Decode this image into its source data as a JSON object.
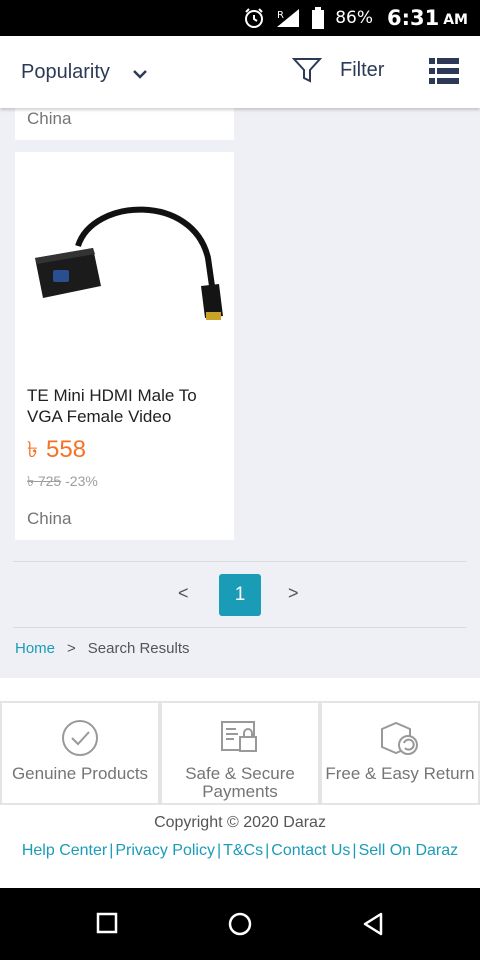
{
  "status_bar": {
    "battery": "86%",
    "time": "6:31",
    "ampm": "AM",
    "signal_label": "R"
  },
  "toolbar": {
    "sort_label": "Popularity",
    "filter_label": "Filter"
  },
  "products": [
    {
      "origin": "China"
    },
    {
      "title": "TE Mini HDMI Male To VGA Female Video",
      "currency": "৳",
      "price": "558",
      "old_price": "৳ 725",
      "discount": "-23%",
      "origin": "China"
    }
  ],
  "pagination": {
    "prev": "<",
    "current": "1",
    "next": ">"
  },
  "breadcrumb": {
    "home": "Home",
    "separator": ">",
    "current": "Search Results"
  },
  "footer": {
    "features": [
      {
        "label": "Genuine Products",
        "icon": "check-badge-icon"
      },
      {
        "label": "Safe & Secure Payments",
        "icon": "secure-payment-icon"
      },
      {
        "label": "Free & Easy Return",
        "icon": "return-box-icon"
      }
    ],
    "copyright": "Copyright © 2020 Daraz",
    "links": [
      "Help Center",
      "Privacy Policy",
      "T&Cs",
      "Contact Us",
      "Sell On Daraz"
    ]
  },
  "colors": {
    "accent": "#1a9cb7",
    "price": "#f57224",
    "background": "#eff0f5"
  }
}
